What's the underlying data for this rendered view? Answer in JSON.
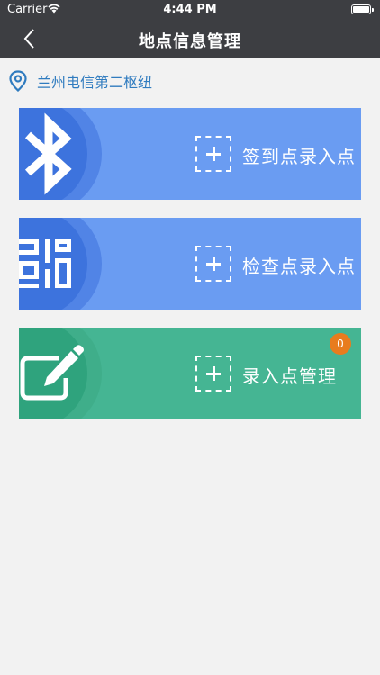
{
  "status_bar": {
    "carrier": "Carrier",
    "time": "4:44 PM"
  },
  "nav": {
    "title": "地点信息管理",
    "back_icon": "chevron-left-icon"
  },
  "location": {
    "icon": "location-pin-icon",
    "name": "兰州电信第二枢纽"
  },
  "cards": [
    {
      "label": "签到点录入点",
      "icon": "bluetooth-icon",
      "color": "#6a9cf2"
    },
    {
      "label": "检查点录入点",
      "icon": "qr-code-icon",
      "color": "#6a9cf2"
    },
    {
      "label": "录入点管理",
      "icon": "edit-icon",
      "color": "#45b593",
      "badge": "0"
    }
  ],
  "colors": {
    "nav_bg": "#3d3e42",
    "location_text": "#2f7bbf",
    "badge": "#e87c1e"
  }
}
